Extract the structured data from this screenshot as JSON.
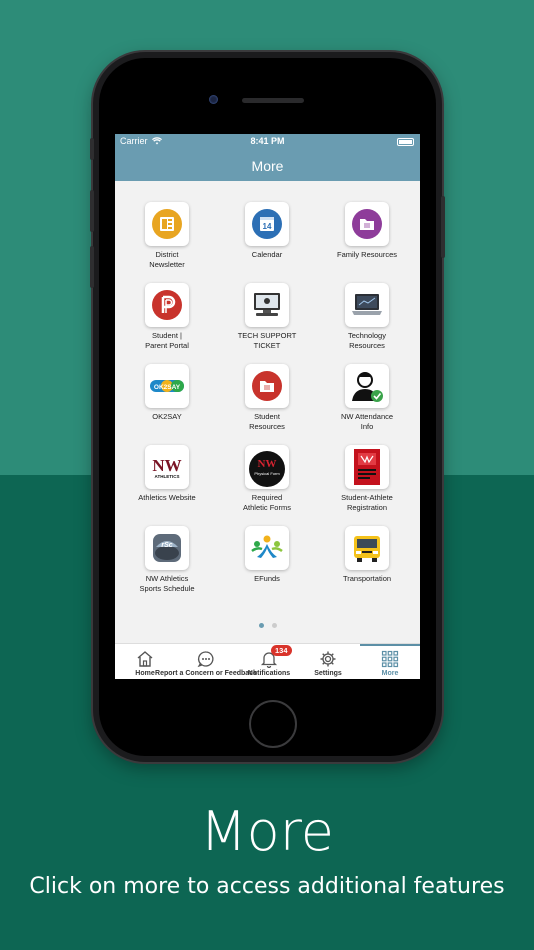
{
  "status": {
    "carrier": "Carrier",
    "time": "8:41 PM"
  },
  "nav": {
    "title": "More"
  },
  "tiles": [
    {
      "label": "District\nNewsletter",
      "icon": "newspaper-icon"
    },
    {
      "label": "Calendar",
      "icon": "calendar-icon",
      "day": "14"
    },
    {
      "label": "Family Resources",
      "icon": "folder-icon"
    },
    {
      "label": "Student |\nParent Portal",
      "icon": "portal-icon"
    },
    {
      "label": "TECH SUPPORT\nTICKET",
      "icon": "computer-icon"
    },
    {
      "label": "Technology\nResources",
      "icon": "laptop-icon"
    },
    {
      "label": "OK2SAY",
      "icon": "ok2say-logo",
      "logo_text": "OK2SAY"
    },
    {
      "label": "Student\nResources",
      "icon": "folder-icon"
    },
    {
      "label": "NW Attendance\nInfo",
      "icon": "person-check-icon"
    },
    {
      "label": "Athletics Website",
      "icon": "nw-athletics-logo",
      "logo_text": "NW",
      "logo_sub": "ATHLETICS"
    },
    {
      "label": "Required\nAthletic Forms",
      "icon": "physical-form-icon",
      "logo_text": "NW",
      "logo_sub": "Physical Form"
    },
    {
      "label": "Student-Athlete\nRegistration",
      "icon": "registration-icon"
    },
    {
      "label": "NW Athletics\nSports Schedule",
      "icon": "schedule-app-icon",
      "logo_text": "rSc"
    },
    {
      "label": "EFunds",
      "icon": "efunds-icon"
    },
    {
      "label": "Transportation",
      "icon": "bus-icon"
    }
  ],
  "tabs": [
    {
      "label": "Home",
      "icon": "home-icon"
    },
    {
      "label": "Report a Concern or Feedback",
      "icon": "chat-icon"
    },
    {
      "label": "Notifications",
      "icon": "bell-icon",
      "badge": "134"
    },
    {
      "label": "Settings",
      "icon": "gear-icon"
    },
    {
      "label": "More",
      "icon": "grid-icon",
      "active": true
    }
  ],
  "caption": {
    "title": "More",
    "subtitle": "Click on more to access additional features"
  },
  "colors": {
    "background_top": "#2d8c78",
    "background_bottom": "#0d6653",
    "header": "#6a9cb1",
    "accent": "#5c8fa6",
    "badge": "#d9342b"
  }
}
